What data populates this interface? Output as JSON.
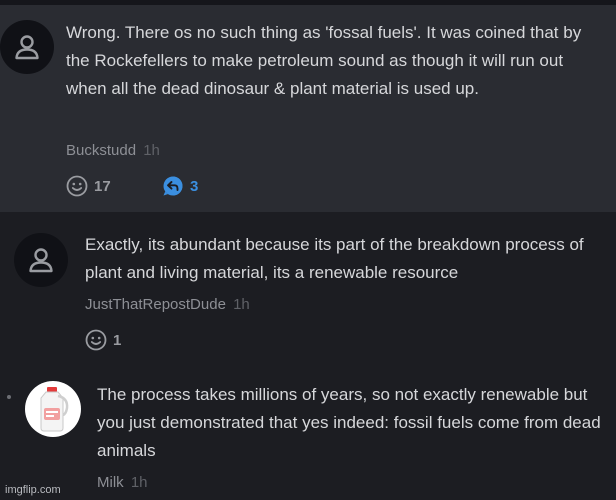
{
  "comments": [
    {
      "text": "Wrong. There os no such thing as 'fossal fuels'. It was coined that by the Rockefellers to make petroleum sound as though it will run out when all the dead dinosaur & plant material is used up.",
      "author": "Buckstudd",
      "time": "1h",
      "likes": "17",
      "replies": "3"
    },
    {
      "text": "Exactly, its abundant because its part of the breakdown process of plant and living material, its a renewable resource",
      "author": "JustThatRepostDude",
      "time": "1h",
      "likes": "1"
    },
    {
      "text": "The process takes millions of years, so not exactly renewable but you just demonstrated that yes indeed: fossil fuels come from dead animals",
      "author": "Milk",
      "time": "1h"
    }
  ],
  "watermark": "imgflip.com",
  "colors": {
    "reply_accent": "#3b8fe0",
    "icon_gray": "#9a9ca1"
  }
}
